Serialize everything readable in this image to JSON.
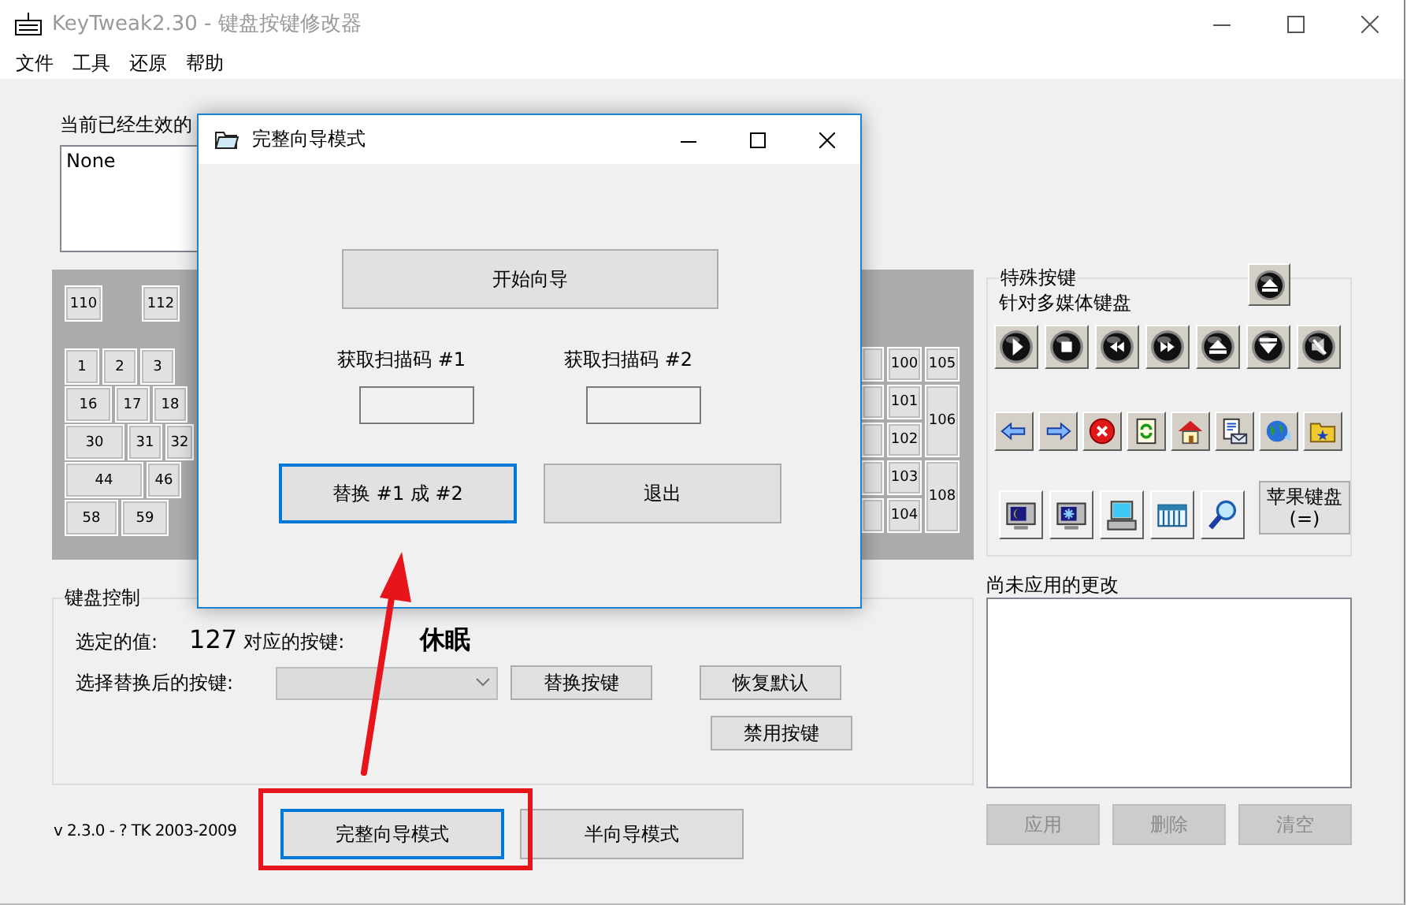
{
  "window": {
    "title": "KeyTweak2.30 - 键盘按键修改器"
  },
  "menu": [
    "文件",
    "工具",
    "还原",
    "帮助"
  ],
  "current_remaps": {
    "label": "当前已经生效的",
    "items": [
      "None"
    ]
  },
  "keyboard": {
    "left_rows": [
      [
        "110",
        "112"
      ],
      [
        "1",
        "2",
        "3"
      ],
      [
        "16",
        "17",
        "18"
      ],
      [
        "30",
        "31",
        "32"
      ],
      [
        "44",
        "46"
      ],
      [
        "58",
        "59"
      ]
    ],
    "right_keys": [
      "100",
      "105",
      "101",
      "106",
      "102",
      "103",
      "108",
      "104"
    ]
  },
  "special_keys": {
    "title": "特殊按键",
    "subtitle": "针对多媒体键盘",
    "apple_button": "苹果键盘 (=)"
  },
  "keyboard_control": {
    "title": "键盘控制",
    "selected_value_label": "选定的值:",
    "selected_value": "127",
    "mapped_key_label": "对应的按键:",
    "mapped_key": "休眠",
    "replace_label": "选择替换后的按键:",
    "dropdown": {
      "disabled": true
    },
    "buttons": [
      {
        "label": "替换按键"
      },
      {
        "label": "恢复默认"
      },
      {
        "label": "禁用按键"
      }
    ]
  },
  "pending_changes": {
    "title": "尚未应用的更改",
    "buttons": [
      {
        "label": "应用",
        "disabled": true
      },
      {
        "label": "删除",
        "disabled": true
      },
      {
        "label": "清空",
        "disabled": true
      }
    ]
  },
  "footer": {
    "version": "v 2.3.0 - ? TK 2003-2009",
    "buttons": [
      {
        "label": "完整向导模式",
        "focused": true
      },
      {
        "label": "半向导模式",
        "focused": false
      }
    ]
  },
  "dialog": {
    "title": "完整向导模式",
    "start_button": "开始向导",
    "scan_fields": [
      {
        "label": "获取扫描码 #1"
      },
      {
        "label": "获取扫描码 #2"
      }
    ],
    "buttons": [
      {
        "label": "替换 #1 成 #2",
        "focused": true
      },
      {
        "label": "退出",
        "focused": false
      }
    ]
  }
}
